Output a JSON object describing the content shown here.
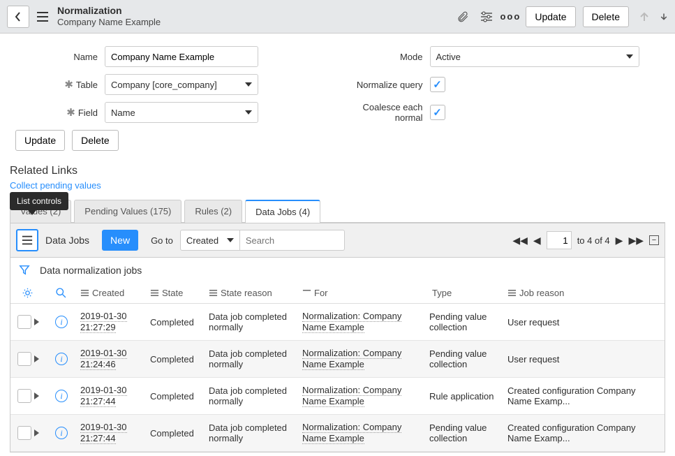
{
  "header": {
    "title": "Normalization",
    "subtitle": "Company Name Example",
    "update_btn": "Update",
    "delete_btn": "Delete"
  },
  "tooltip": {
    "text": "List controls"
  },
  "form": {
    "name_label": "Name",
    "name_value": "Company Name Example",
    "table_label": "Table",
    "table_value": "Company [core_company]",
    "field_label": "Field",
    "field_value": "Name",
    "mode_label": "Mode",
    "mode_value": "Active",
    "normalize_label": "Normalize query",
    "coalesce_label": "Coalesce each normal",
    "update_btn": "Update",
    "delete_btn": "Delete"
  },
  "related": {
    "heading": "Related Links",
    "link": "Collect pending values"
  },
  "tabs": [
    {
      "label": "Values (2)"
    },
    {
      "label": "Pending Values (175)"
    },
    {
      "label": "Rules (2)"
    },
    {
      "label": "Data Jobs (4)"
    }
  ],
  "list_toolbar": {
    "title": "Data Jobs",
    "new_btn": "New",
    "goto_label": "Go to",
    "goto_value": "Created",
    "search_placeholder": "Search",
    "page_value": "1",
    "page_text": "to 4 of 4"
  },
  "list_desc": "Data normalization jobs",
  "columns": {
    "created": "Created",
    "state": "State",
    "state_reason": "State reason",
    "for": "For",
    "type": "Type",
    "job_reason": "Job reason"
  },
  "rows": [
    {
      "created_d": "2019-01-30",
      "created_t": "21:27:29",
      "state": "Completed",
      "reason": "Data job completed normally",
      "for1": "Normalization: Company",
      "for2": "Name Example",
      "type": "Pending value collection",
      "job": "User request"
    },
    {
      "created_d": "2019-01-30",
      "created_t": "21:24:46",
      "state": "Completed",
      "reason": "Data job completed normally",
      "for1": "Normalization: Company",
      "for2": "Name Example",
      "type": "Pending value collection",
      "job": "User request"
    },
    {
      "created_d": "2019-01-30",
      "created_t": "21:27:44",
      "state": "Completed",
      "reason": "Data job completed normally",
      "for1": "Normalization: Company",
      "for2": "Name Example",
      "type": "Rule application",
      "job": "Created configuration Company Name Examp..."
    },
    {
      "created_d": "2019-01-30",
      "created_t": "21:27:44",
      "state": "Completed",
      "reason": "Data job completed normally",
      "for1": "Normalization: Company",
      "for2": "Name Example",
      "type": "Pending value collection",
      "job": "Created configuration Company Name Examp..."
    }
  ]
}
